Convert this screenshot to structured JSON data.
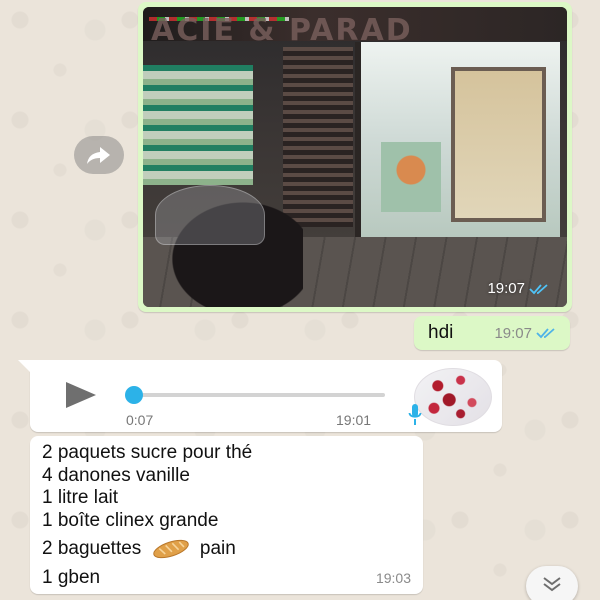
{
  "photo_message": {
    "sign_text": "ACIE & PARAD",
    "time": "19:07",
    "status_icon": "double-check-icon"
  },
  "forward_button": {
    "icon": "forward-arrow-icon"
  },
  "outgoing_text": {
    "text": "hdi",
    "time": "19:07",
    "status_icon": "double-check-icon"
  },
  "voice_message": {
    "play_icon": "play-icon",
    "duration": "0:07",
    "time": "19:01",
    "progress": 0.0,
    "mic_icon": "mic-icon"
  },
  "list_message": {
    "lines": [
      "2 paquets sucre pour thé",
      "4 danones vanille",
      "1 litre lait",
      "1 boîte clinex grande",
      "2 baguettes",
      "pain",
      "1 gben"
    ],
    "emoji": "baguette-bread-icon",
    "time": "19:03"
  },
  "scroll_button": {
    "icon": "double-chevron-down-icon"
  },
  "colors": {
    "outgoing_bubble": "#dcf8c6",
    "incoming_bubble": "#ffffff",
    "read_ticks": "#4fc3f7",
    "accent_blue": "#2cb2e8"
  }
}
